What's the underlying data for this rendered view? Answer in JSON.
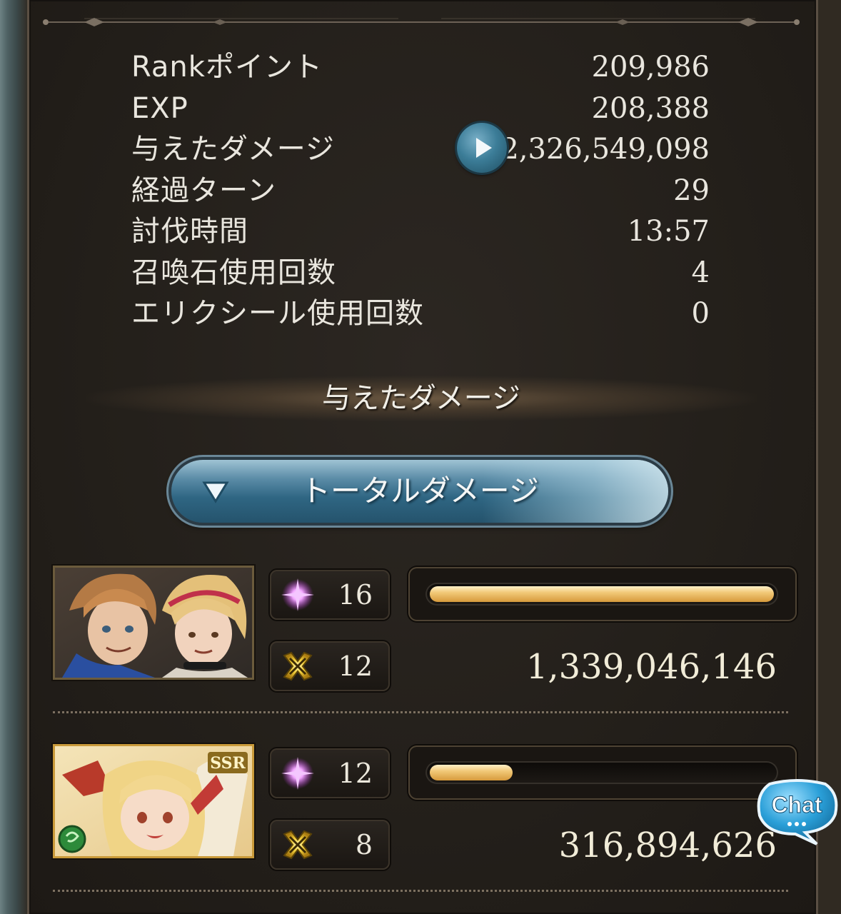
{
  "stats": [
    {
      "label": "Rankポイント",
      "value": "209,986"
    },
    {
      "label": "EXP",
      "value": "208,388"
    },
    {
      "label": "与えたダメージ",
      "value": "2,326,549,098"
    },
    {
      "label": "経過ターン",
      "value": "29"
    },
    {
      "label": "討伐時間",
      "value": "13:57"
    },
    {
      "label": "召喚石使用回数",
      "value": "4"
    },
    {
      "label": "エリクシール使用回数",
      "value": "0"
    }
  ],
  "section_title": "与えたダメージ",
  "toggle_label": "トータルダメージ",
  "characters": [
    {
      "skills": "16",
      "attacks": "12",
      "damage": "1,339,046,146",
      "bar_fraction": 1.0
    },
    {
      "skills": "12",
      "attacks": "8",
      "damage": "316,894,626",
      "bar_fraction": 0.24,
      "badge": "SSR"
    }
  ],
  "chat_label": "Chat",
  "icons": {
    "play": "play-icon",
    "triangle": "triangle-down-icon",
    "skill": "sparkle-icon",
    "attack": "crossed-swords-icon"
  },
  "colors": {
    "bar_fill": "#f2c978",
    "toggle": "#2f6683",
    "text": "#e9e6de"
  }
}
